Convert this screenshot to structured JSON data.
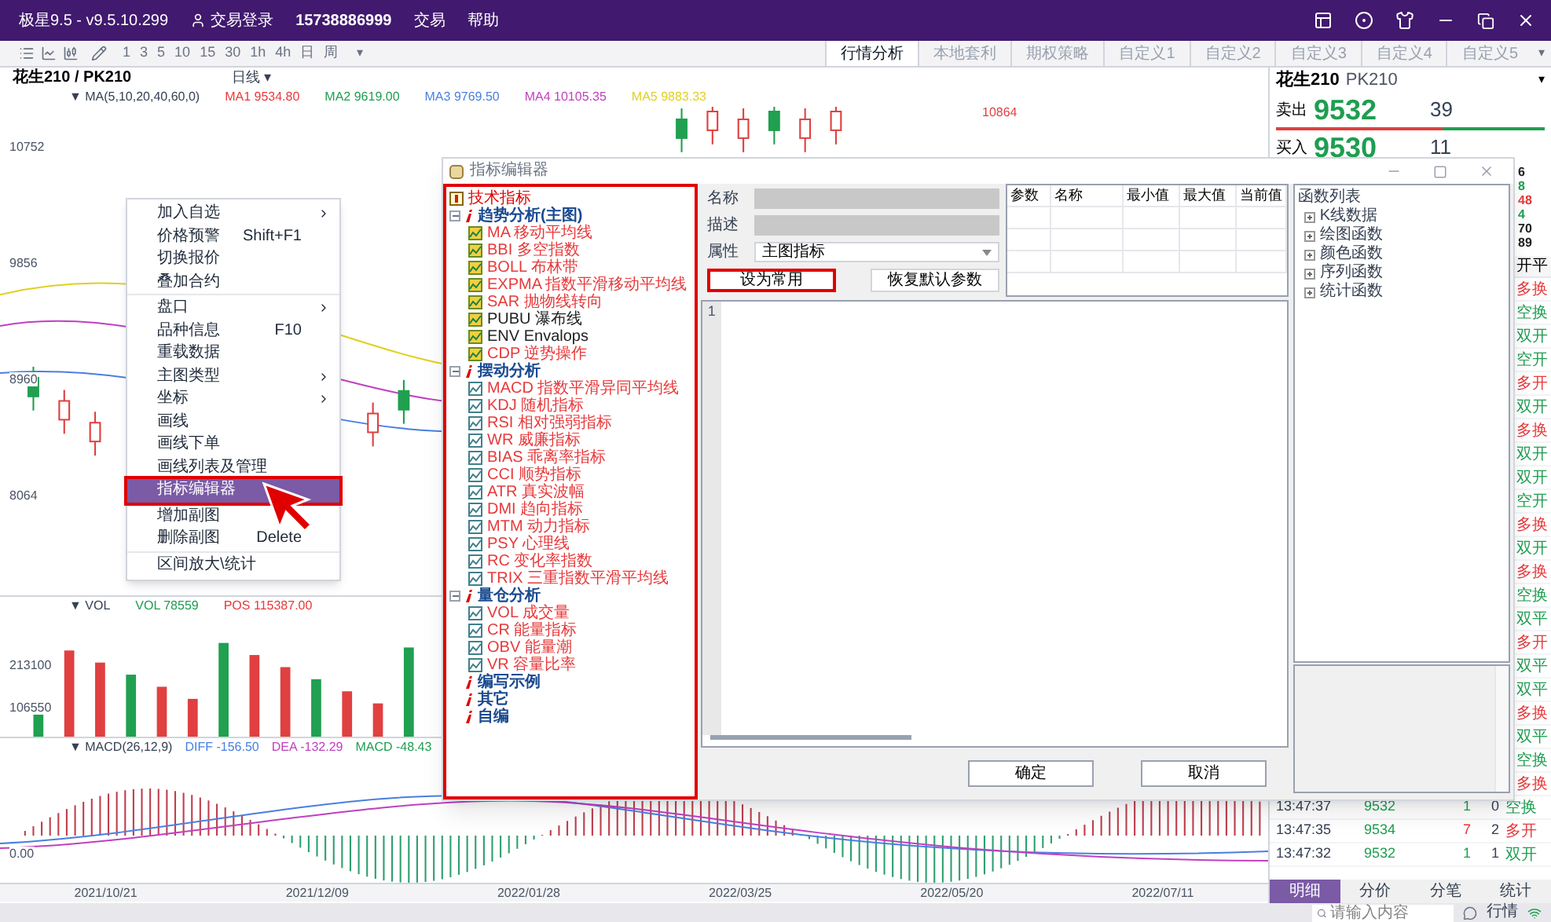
{
  "title_bar": {
    "app_title": "极星9.5 - v9.5.10.299",
    "login": "交易登录",
    "account": "15738886999",
    "menu": [
      "交易",
      "帮助"
    ]
  },
  "toolbar": {
    "intervals": [
      "1",
      "3",
      "5",
      "10",
      "15",
      "30",
      "1h",
      "4h",
      "日",
      "周"
    ],
    "more": "▾"
  },
  "tabs": [
    {
      "label": "行情分析",
      "selected": true
    },
    {
      "label": "本地套利",
      "selected": false
    },
    {
      "label": "期权策略",
      "selected": false
    },
    {
      "label": "自定义1",
      "selected": false
    },
    {
      "label": "自定义2",
      "selected": false
    },
    {
      "label": "自定义3",
      "selected": false
    },
    {
      "label": "自定义4",
      "selected": false
    },
    {
      "label": "自定义5",
      "selected": false
    }
  ],
  "tabs_more": "▾",
  "chart": {
    "symbol": "花生210 / PK210",
    "period": "日线 ▾",
    "ma_label": "▼ MA(5,10,20,40,60,0)",
    "ma_items": [
      {
        "text": "MA1 9534.80",
        "color": "#e8393b"
      },
      {
        "text": "MA2 9619.00",
        "color": "#1e9e50"
      },
      {
        "text": "MA3 9769.50",
        "color": "#4a7fe0"
      },
      {
        "text": "MA4 10105.35",
        "color": "#c040c0"
      },
      {
        "text": "MA5 9883.33",
        "color": "#e0d020"
      }
    ],
    "price_axis": [
      "10752",
      "9856",
      "8960",
      "8064"
    ],
    "high_label": "10864",
    "vol_label": "▼ VOL",
    "vol_items": [
      {
        "text": "VOL 78559",
        "color": "#1e9e50"
      },
      {
        "text": "POS 115387.00",
        "color": "#e8393b"
      }
    ],
    "vol_axis": [
      "213100",
      "106550"
    ],
    "macd_label": "▼ MACD(26,12,9)",
    "macd_items": [
      {
        "text": "DIFF -156.50",
        "color": "#4a7fe0"
      },
      {
        "text": "DEA -132.29",
        "color": "#c040c0"
      },
      {
        "text": "MACD -48.43",
        "color": "#1e9e50"
      }
    ],
    "macd_axis": [
      "0.00"
    ],
    "dates": [
      "2021/10/21",
      "2021/12/09",
      "2022/01/28",
      "2022/03/25",
      "2022/05/20",
      "2022/07/11"
    ]
  },
  "context_menu": {
    "sections": [
      [
        {
          "label": "加入自选",
          "submenu": true,
          "selected": false
        },
        {
          "label": "价格预警",
          "shortcut": "Shift+F1",
          "submenu": false,
          "selected": false
        },
        {
          "label": "切换报价",
          "submenu": false,
          "selected": false
        },
        {
          "label": "叠加合约",
          "submenu": false,
          "selected": false
        }
      ],
      [
        {
          "label": "盘口",
          "submenu": true,
          "selected": false
        },
        {
          "label": "品种信息",
          "shortcut": "F10",
          "submenu": false,
          "selected": false
        },
        {
          "label": "重载数据",
          "submenu": false,
          "selected": false
        },
        {
          "label": "主图类型",
          "submenu": true,
          "selected": false
        },
        {
          "label": "坐标",
          "submenu": true,
          "selected": false
        },
        {
          "label": "画线",
          "submenu": false,
          "selected": false
        },
        {
          "label": "画线下单",
          "submenu": false,
          "selected": false
        },
        {
          "label": "画线列表及管理",
          "submenu": false,
          "selected": false
        },
        {
          "label": "指标编辑器",
          "submenu": false,
          "selected": true
        }
      ],
      [
        {
          "label": "增加副图",
          "submenu": false,
          "selected": false
        },
        {
          "label": "删除副图",
          "shortcut": "Delete",
          "submenu": false,
          "selected": false
        }
      ],
      [
        {
          "label": "区间放大\\统计",
          "submenu": false,
          "selected": false
        }
      ]
    ]
  },
  "dialog": {
    "title": "指标编辑器",
    "tree": {
      "root": "技术指标",
      "groups": [
        {
          "label": "趋势分析(主图)",
          "kind": "main",
          "children": [
            {
              "label": "MA 移动平均线",
              "color": "#e8393b"
            },
            {
              "label": "BBI 多空指数",
              "color": "#e8393b"
            },
            {
              "label": "BOLL 布林带",
              "color": "#e8393b"
            },
            {
              "label": "EXPMA 指数平滑移动平均线",
              "color": "#e8393b"
            },
            {
              "label": "SAR 抛物线转向",
              "color": "#e8393b"
            },
            {
              "label": "PUBU 瀑布线",
              "color": "#222222"
            },
            {
              "label": "ENV Envalops",
              "color": "#222222"
            },
            {
              "label": "CDP 逆势操作",
              "color": "#e8393b"
            }
          ]
        },
        {
          "label": "摆动分析",
          "kind": "sub",
          "children": [
            {
              "label": "MACD 指数平滑异同平均线",
              "color": "#e8393b"
            },
            {
              "label": "KDJ 随机指标",
              "color": "#e8393b"
            },
            {
              "label": "RSI 相对强弱指标",
              "color": "#e8393b"
            },
            {
              "label": "WR 威廉指标",
              "color": "#e8393b"
            },
            {
              "label": "BIAS 乖离率指标",
              "color": "#e8393b"
            },
            {
              "label": "CCI 顺势指标",
              "color": "#e8393b"
            },
            {
              "label": "ATR 真实波幅",
              "color": "#e8393b"
            },
            {
              "label": "DMI 趋向指标",
              "color": "#e8393b"
            },
            {
              "label": "MTM 动力指标",
              "color": "#e8393b"
            },
            {
              "label": "PSY 心理线",
              "color": "#e8393b"
            },
            {
              "label": "RC 变化率指数",
              "color": "#e8393b"
            },
            {
              "label": "TRIX 三重指数平滑平均线",
              "color": "#e8393b"
            }
          ]
        },
        {
          "label": "量仓分析",
          "kind": "sub",
          "children": [
            {
              "label": "VOL 成交量",
              "color": "#e8393b"
            },
            {
              "label": "CR 能量指标",
              "color": "#e8393b"
            },
            {
              "label": "OBV 能量潮",
              "color": "#e8393b"
            },
            {
              "label": "VR 容量比率",
              "color": "#e8393b"
            }
          ]
        },
        {
          "label": "编写示例"
        },
        {
          "label": "其它"
        },
        {
          "label": "自编"
        }
      ]
    },
    "fields": [
      {
        "label": "名称",
        "kind": "text"
      },
      {
        "label": "描述",
        "kind": "text"
      },
      {
        "label": "属性",
        "kind": "select",
        "value": "主图指标"
      }
    ],
    "form_buttons": [
      {
        "label": "设为常用",
        "highlighted": true
      },
      {
        "label": "恢复默认参数",
        "highlighted": false
      }
    ],
    "param_columns": [
      "参数",
      "名称",
      "最小值",
      "最大值",
      "当前值"
    ],
    "line_numbers": [
      "1"
    ],
    "functions": {
      "title": "函数列表",
      "items": [
        "K线数据",
        "绘图函数",
        "颜色函数",
        "序列函数",
        "统计函数"
      ]
    },
    "buttons": [
      "确定",
      "取消"
    ]
  },
  "quote": {
    "name": "花生210",
    "code": "PK210",
    "more": "▾",
    "ask": {
      "label": "卖出",
      "price": "9532",
      "volume": "39"
    },
    "bid": {
      "label": "买入",
      "price": "9530",
      "volume": "11"
    },
    "fragments": [
      {
        "text": "6",
        "color": "#222222"
      },
      {
        "text": "8",
        "color": "#1e9e50"
      },
      {
        "text": "48",
        "color": "#e8393b"
      },
      {
        "text": "4",
        "color": "#1e9e50"
      },
      {
        "text": "70",
        "color": "#222222"
      },
      {
        "text": "89",
        "color": "#222222"
      }
    ]
  },
  "trades": {
    "header": "开平",
    "rows": [
      {
        "action": "多换",
        "color": "#e8393b"
      },
      {
        "action": "空换",
        "color": "#1e9e50"
      },
      {
        "action": "双开",
        "color": "#1e9e50"
      },
      {
        "action": "空开",
        "color": "#1e9e50"
      },
      {
        "action": "多开",
        "color": "#e8393b"
      },
      {
        "action": "双开",
        "color": "#1e9e50"
      },
      {
        "action": "多换",
        "color": "#e8393b"
      },
      {
        "action": "双开",
        "color": "#1e9e50"
      },
      {
        "action": "双开",
        "color": "#1e9e50"
      },
      {
        "action": "空开",
        "color": "#1e9e50"
      },
      {
        "action": "多换",
        "color": "#e8393b"
      },
      {
        "action": "双开",
        "color": "#1e9e50"
      },
      {
        "action": "多换",
        "color": "#e8393b"
      },
      {
        "action": "空换",
        "color": "#1e9e50"
      },
      {
        "action": "双平",
        "color": "#1e9e50"
      },
      {
        "action": "多开",
        "color": "#e8393b"
      },
      {
        "action": "双平",
        "color": "#1e9e50"
      },
      {
        "action": "双平",
        "color": "#1e9e50"
      },
      {
        "action": "多换",
        "color": "#e8393b"
      },
      {
        "action": "双平",
        "color": "#1e9e50"
      },
      {
        "action": "空换",
        "color": "#1e9e50"
      },
      {
        "action": "多换",
        "color": "#e8393b"
      },
      {
        "time": "13:47:37",
        "price": "9532",
        "volume": {
          "text": "1",
          "color": "#1e9e50"
        },
        "change": "0",
        "action": "空换",
        "color": "#1e9e50"
      },
      {
        "time": "13:47:35",
        "price": "9534",
        "volume": {
          "text": "7",
          "color": "#e8393b"
        },
        "change": "2",
        "action": "多开",
        "color": "#e8393b"
      },
      {
        "time": "13:47:32",
        "price": "9532",
        "volume": {
          "text": "1",
          "color": "#1e9e50"
        },
        "change": "1",
        "action": "双开",
        "color": "#1e9e50"
      }
    ]
  },
  "bottom_tabs": [
    {
      "label": "明细",
      "selected": true
    },
    {
      "label": "分价",
      "selected": false
    },
    {
      "label": "分笔",
      "selected": false
    },
    {
      "label": "统计",
      "selected": false
    }
  ],
  "status_bar": {
    "search_placeholder": "请输入内容",
    "market": "行情"
  }
}
